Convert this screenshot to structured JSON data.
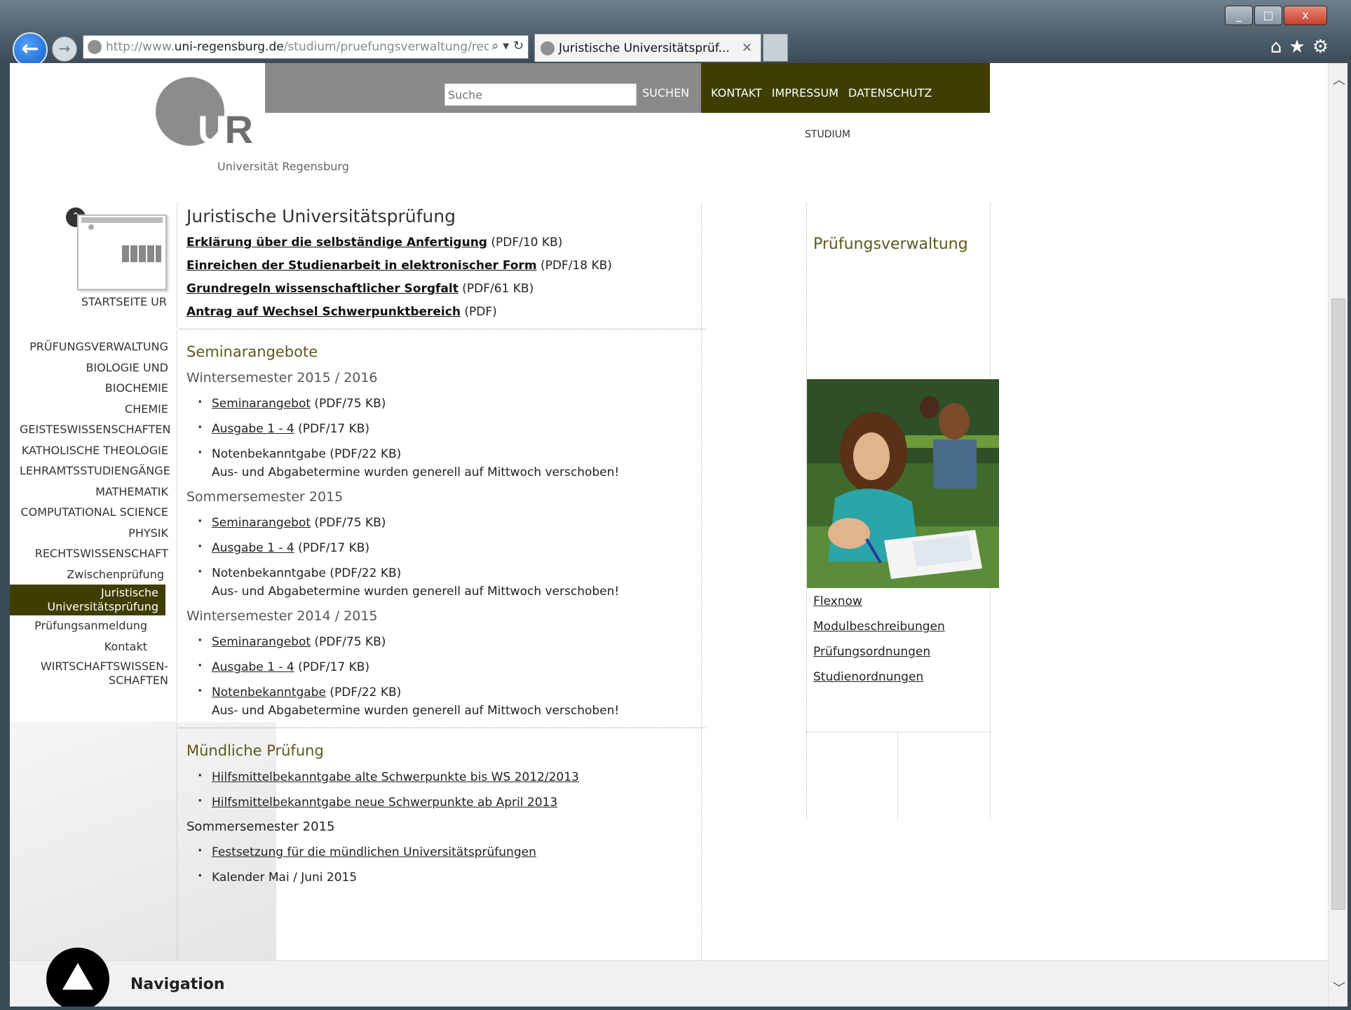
{
  "browser": {
    "url_prefix": "http://www.",
    "url_domain": "uni-regensburg.de",
    "url_path": "/studium/pruefungsverwaltung/rechtsv",
    "tab_title": "Juristische Universitätsprüf...",
    "win_minimize": "_",
    "win_maximize": "□",
    "win_close": "x",
    "icons": [
      "home-icon",
      "favorites-star-icon",
      "settings-gear-icon"
    ]
  },
  "header": {
    "logo_text": "Universität Regensburg",
    "logo_letters": [
      "U",
      "R"
    ],
    "search_placeholder": "Suche",
    "search_button": "SUCHEN",
    "topnav": [
      "KONTAKT",
      "IMPRESSUM",
      "DATENSCHUTZ"
    ],
    "breadcrumb": "STUDIUM"
  },
  "leftnav": {
    "home_label": "STARTSEITE UR",
    "items": [
      "PRÜFUNGSVERWALTUNG",
      "BIOLOGIE UND BIOCHEMIE",
      "CHEMIE",
      "GEISTESWISSENSCHAFTEN",
      "KATHOLISCHE THEOLOGIE",
      "LEHRAMTSSTUDIENGÄNGE",
      "MATHEMATIK",
      "COMPUTATIONAL SCIENCE",
      "PHYSIK",
      "RECHTSWISSENSCHAFT"
    ],
    "sub_zwischen": "Zwischenprüfung",
    "active_line1": "Juristische",
    "active_line2": "Universitätsprüfung",
    "sub2_anmeldung": "Prüfungsanmeldung",
    "sub2_kontakt": "Kontakt",
    "last_line1": "WIRTSCHAFTSWISSEN-",
    "last_line2": "SCHAFTEN"
  },
  "main": {
    "title": "Juristische Universitätsprüfung",
    "docs": [
      {
        "link": "Erklärung über die selbständige Anfertigung",
        "meta": " (PDF/10 KB)"
      },
      {
        "link": "Einreichen der Studienarbeit in elektronischer Form",
        "meta": " (PDF/18 KB)"
      },
      {
        "link": "Grundregeln wissenschaftlicher Sorgfalt",
        "meta": " (PDF/61 KB)"
      },
      {
        "link": "Antrag auf Wechsel Schwerpunktbereich",
        "meta": " (PDF)"
      }
    ],
    "seminar_heading": "Seminarangebote",
    "semesters": [
      {
        "name": "Wintersemester 2015 / 2016",
        "seminar_link": "Seminarangebot",
        "seminar_meta": " (PDF/75 KB)",
        "ausgabe_link": "Ausgabe 1 - 4",
        "ausgabe_meta": " (PDF/17 KB)",
        "noten_text": "Notenbekanntgabe",
        "noten_meta": " (PDF/22 KB)",
        "note": "Aus- und Abgabetermine wurden generell auf Mittwoch verschoben!"
      },
      {
        "name": "Sommersemester 2015",
        "seminar_link": "Seminarangebot",
        "seminar_meta": " (PDF/75 KB)",
        "ausgabe_link": "Ausgabe 1 - 4",
        "ausgabe_meta": " (PDF/17 KB)",
        "noten_text": "Notenbekanntgabe",
        "noten_meta": " (PDF/22 KB)",
        "note": "Aus- und Abgabetermine wurden generell auf Mittwoch verschoben!"
      },
      {
        "name": "Wintersemester 2014 / 2015",
        "seminar_link": "Seminarangebot",
        "seminar_meta": " (PDF/75 KB)",
        "ausgabe_link": "Ausgabe 1 - 4",
        "ausgabe_meta": " (PDF/17 KB)",
        "noten_text": "Notenbekanntgabe",
        "noten_meta": " (PDF/22 KB)",
        "note": "Aus- und Abgabetermine wurden generell auf Mittwoch verschoben!"
      }
    ],
    "oral_heading": "Mündliche Prüfung",
    "oral_links": [
      "Hilfsmittelbekanntgabe alte Schwerpunkte bis WS 2012/2013",
      "Hilfsmittelbekanntgabe neue Schwerpunkte ab April 2013"
    ],
    "oral_semester": "Sommersemester 2015",
    "oral_festsetzung": "Festsetzung für die mündlichen Universitätsprüfungen",
    "oral_kalender": "Kalender Mai / Juni 2015"
  },
  "right": {
    "title": "Prüfungsverwaltung",
    "links": [
      "Flexnow",
      "Modulbeschreibungen",
      "Prüfungsordnungen",
      "Studienordnungen"
    ]
  },
  "bottom": {
    "nav_label": "Navigation"
  }
}
